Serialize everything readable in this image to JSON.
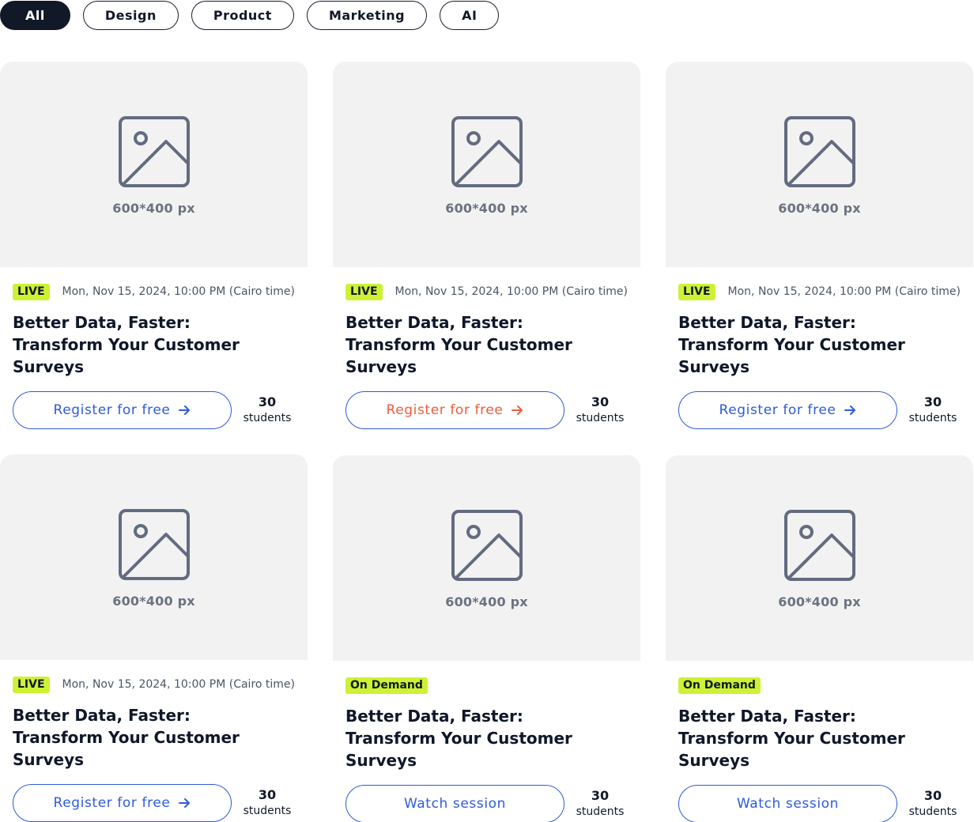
{
  "filters": [
    {
      "label": "All",
      "active": true
    },
    {
      "label": "Design",
      "active": false
    },
    {
      "label": "Product",
      "active": false
    },
    {
      "label": "Marketing",
      "active": false
    },
    {
      "label": "AI",
      "active": false
    }
  ],
  "colors": {
    "accent": "#2e5bd8",
    "hover_accent": "#ef5b3b",
    "badge": "#cdf234",
    "chip_active": "#111827",
    "thumb_bg": "#f2f2f2"
  },
  "cards": [
    {
      "placeholder": "600*400 px",
      "badge": "LIVE",
      "date": "Mon, Nov 15, 2024, 10:00 PM (Cairo time)",
      "title": "Better Data, Faster: Transform Your Customer Surveys",
      "cta": "Register for free",
      "cta_icon": "arrow-right-icon",
      "count": "30",
      "count_label": "students"
    },
    {
      "placeholder": "600*400 px",
      "badge": "LIVE",
      "date": "Mon, Nov 15, 2024, 10:00 PM (Cairo time)",
      "title": "Better Data, Faster: Transform Your Customer Surveys",
      "cta": "Register for free",
      "cta_icon": "arrow-right-icon",
      "count": "30",
      "count_label": "students"
    },
    {
      "placeholder": "600*400 px",
      "badge": "LIVE",
      "date": "Mon, Nov 15, 2024, 10:00 PM (Cairo time)",
      "title": "Better Data, Faster: Transform Your Customer Surveys",
      "cta": "Register for free",
      "cta_icon": "arrow-right-icon",
      "count": "30",
      "count_label": "students"
    },
    {
      "placeholder": "600*400 px",
      "badge": "LIVE",
      "date": "Mon, Nov 15, 2024, 10:00 PM (Cairo time)",
      "title": "Better Data, Faster: Transform Your Customer Surveys",
      "cta": "Register for free",
      "cta_icon": "arrow-right-icon",
      "count": "30",
      "count_label": "students"
    },
    {
      "placeholder": "600*400 px",
      "badge": "On Demand",
      "date": "",
      "title": "Better Data, Faster: Transform Your Customer Surveys",
      "cta": "Watch session",
      "cta_icon": "",
      "count": "30",
      "count_label": "students"
    },
    {
      "placeholder": "600*400 px",
      "badge": "On Demand",
      "date": "",
      "title": "Better Data, Faster: Transform Your Customer Surveys",
      "cta": "Watch session",
      "cta_icon": "",
      "count": "30",
      "count_label": "students"
    }
  ]
}
